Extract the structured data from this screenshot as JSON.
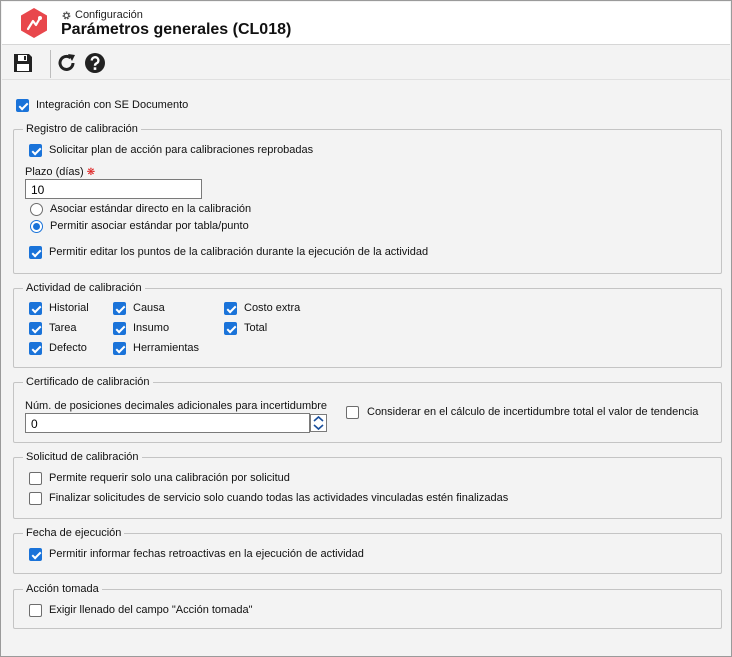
{
  "header": {
    "module": "Configuración",
    "title": "Parámetros generales (CL018)",
    "accent": "#e8474c"
  },
  "toolbar": {
    "save_icon": "save-icon",
    "refresh_icon": "refresh-icon",
    "help_icon": "help-icon"
  },
  "integration": {
    "label": "Integración con SE Documento",
    "checked": true
  },
  "registro": {
    "legend": "Registro de calibración",
    "action_plan": {
      "label": "Solicitar plan de acción para calibraciones reprobadas",
      "checked": true
    },
    "plazo_label": "Plazo (días)",
    "plazo_value": "10",
    "radio_direct": {
      "label": "Asociar estándar directo en la calibración",
      "selected": false
    },
    "radio_table": {
      "label": "Permitir asociar estándar por tabla/punto",
      "selected": true
    },
    "edit_points": {
      "label": "Permitir editar los puntos de la calibración durante la ejecución de la actividad",
      "checked": true
    }
  },
  "actividad": {
    "legend": "Actividad de calibración",
    "items": [
      {
        "label": "Historial",
        "checked": true
      },
      {
        "label": "Causa",
        "checked": true
      },
      {
        "label": "Costo extra",
        "checked": true
      },
      {
        "label": "Tarea",
        "checked": true
      },
      {
        "label": "Insumo",
        "checked": true
      },
      {
        "label": "Total",
        "checked": true
      },
      {
        "label": "Defecto",
        "checked": true
      },
      {
        "label": "Herramientas",
        "checked": true
      }
    ]
  },
  "certificado": {
    "legend": "Certificado de calibración",
    "decimals_label": "Núm. de posiciones decimales adicionales para incertidumbre",
    "decimals_value": "0",
    "trend": {
      "label": "Considerar en el cálculo de incertidumbre total el valor de tendencia",
      "checked": false
    }
  },
  "solicitud": {
    "legend": "Solicitud de calibración",
    "single": {
      "label": "Permite requerir solo una calibración por solicitud",
      "checked": false
    },
    "finalize": {
      "label": "Finalizar solicitudes de servicio solo cuando todas las actividades vinculadas estén finalizadas",
      "checked": false
    }
  },
  "fecha": {
    "legend": "Fecha de ejecución",
    "retro": {
      "label": "Permitir informar fechas retroactivas en la ejecución de actividad",
      "checked": true
    }
  },
  "accion": {
    "legend": "Acción tomada",
    "required": {
      "label": "Exigir llenado del campo \"Acción tomada\"",
      "checked": false
    }
  }
}
